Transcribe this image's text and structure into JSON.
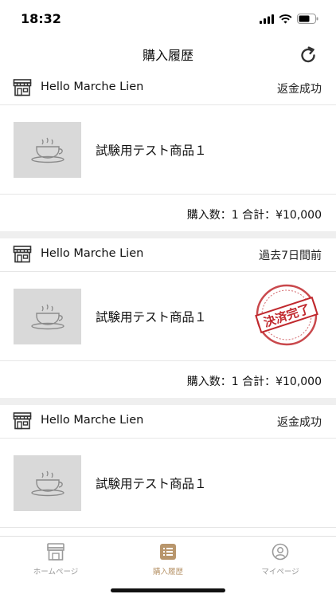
{
  "status_bar": {
    "time": "18:32",
    "icons": [
      "signal-icon",
      "wifi-icon",
      "battery-icon"
    ]
  },
  "header": {
    "title": "購入履歴",
    "refresh_icon": "refresh-icon"
  },
  "orders": [
    {
      "shop_name": "Hello Marche Lien",
      "status": "返金成功",
      "item_name": "試験用テスト商品１",
      "summary": "購入数：1 合計：¥10,000",
      "stamp": null
    },
    {
      "shop_name": "Hello Marche Lien",
      "status": "過去7日間前",
      "item_name": "試験用テスト商品１",
      "summary": "購入数：1 合計：¥10,000",
      "stamp": "決済完了"
    },
    {
      "shop_name": "Hello Marche Lien",
      "status": "返金成功",
      "item_name": "試験用テスト商品１",
      "summary": "",
      "stamp": null
    }
  ],
  "tab_bar": {
    "tabs": [
      {
        "label": "ホームページ",
        "icon": "home-icon",
        "active": false
      },
      {
        "label": "購入履歴",
        "icon": "list-icon",
        "active": true
      },
      {
        "label": "マイページ",
        "icon": "profile-icon",
        "active": false
      }
    ]
  },
  "colors": {
    "accent": "#b8966c",
    "inactive": "#9a9a9a",
    "stamp_red": "#c0282d",
    "separator": "#efefef",
    "thumbnail": "#d9d9d9"
  }
}
